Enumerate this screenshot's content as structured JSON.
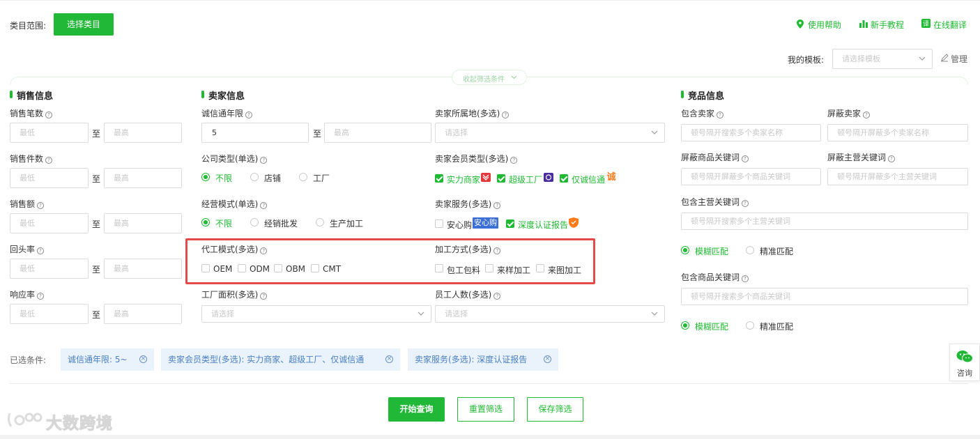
{
  "colors": {
    "accent": "#22b837",
    "highlight": "#e34b4b",
    "tag_bg": "#eaf3fb",
    "tag_text": "#4a7fc1"
  },
  "header": {
    "category_label": "类目范围:",
    "select_category_btn": "选择类目",
    "links": [
      {
        "icon": "help-pin-icon",
        "label": "使用帮助"
      },
      {
        "icon": "tutorial-chart-icon",
        "label": "新手教程"
      },
      {
        "icon": "translate-icon",
        "label": "在线翻译"
      }
    ]
  },
  "template": {
    "label": "我的模板:",
    "placeholder": "请选择模板",
    "manage_label": "管理"
  },
  "collapse_label": "收起筛选条件",
  "sales": {
    "title": "销售信息",
    "fields": [
      {
        "label": "销售笔数",
        "min": "最低",
        "max": "最高"
      },
      {
        "label": "销售件数",
        "min": "最低",
        "max": "最高"
      },
      {
        "label": "销售额",
        "min": "最低",
        "max": "最高"
      },
      {
        "label": "回头率",
        "min": "最低",
        "max": "最高"
      },
      {
        "label": "响应率",
        "min": "最低",
        "max": "最高"
      }
    ],
    "to": "至"
  },
  "seller": {
    "title": "卖家信息",
    "years": {
      "label": "诚信通年限",
      "value": "5",
      "max": "最高"
    },
    "company_type": {
      "label": "公司类型(单选)",
      "options": [
        "不限",
        "店铺",
        "工厂"
      ]
    },
    "business_mode": {
      "label": "经营模式(单选)",
      "options": [
        "不限",
        "经销批发",
        "生产加工"
      ]
    },
    "oem_mode": {
      "label": "代工模式(多选)",
      "options": [
        "OEM",
        "ODM",
        "OBM",
        "CMT"
      ]
    },
    "factory_area": {
      "label": "工厂面积(多选)",
      "placeholder": "请选择"
    },
    "location": {
      "label": "卖家所属地(多选)",
      "placeholder": "请选择"
    },
    "member_type": {
      "label": "卖家会员类型(多选)",
      "options": [
        "实力商家",
        "超级工厂",
        "仅诚信通"
      ]
    },
    "service": {
      "label": "卖家服务(多选)",
      "options": [
        "安心购",
        "深度认证报告"
      ],
      "badge": "安心购"
    },
    "process_mode": {
      "label": "加工方式(多选)",
      "options": [
        "包工包料",
        "来样加工",
        "来图加工"
      ]
    },
    "staff": {
      "label": "员工人数(多选)",
      "placeholder": "请选择"
    }
  },
  "competitor": {
    "title": "竞品信息",
    "include_seller": {
      "label": "包含卖家",
      "placeholder": "顿号隔开搜索多个卖家名称"
    },
    "block_seller": {
      "label": "屏蔽卖家",
      "placeholder": "顿号隔开屏蔽多个卖家名称"
    },
    "block_goods_kw": {
      "label": "屏蔽商品关键词",
      "placeholder": "顿号隔开屏蔽多个商品关键词"
    },
    "block_main_kw": {
      "label": "屏蔽主营关键词",
      "placeholder": "顿号隔开屏蔽多个主营关键词"
    },
    "include_main_kw": {
      "label": "包含主营关键词",
      "placeholder": "顿号隔开搜索多个主营关键词"
    },
    "include_goods_kw": {
      "label": "包含商品关键词",
      "placeholder": "顿号隔开搜索多个商品关键词"
    },
    "match": [
      "模糊匹配",
      "精准匹配"
    ]
  },
  "selected": {
    "label": "已选条件:",
    "tags": [
      "诚信通年限: 5~",
      "卖家会员类型(多选): 实力商家、超级工厂、仅诚信通",
      "卖家服务(多选): 深度认证报告"
    ]
  },
  "consult_label": "咨询",
  "actions": {
    "query": "开始查询",
    "reset": "重置筛选",
    "save": "保存筛选"
  },
  "watermark": "大数跨境"
}
